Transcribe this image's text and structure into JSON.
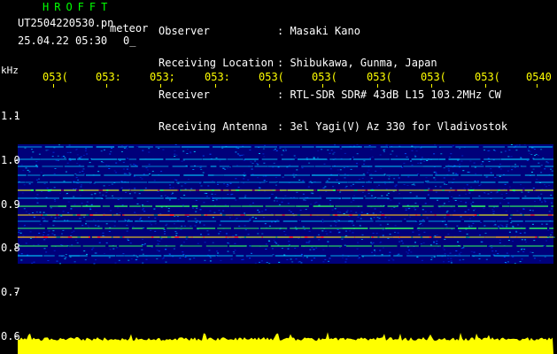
{
  "header": {
    "app_title": "HROFFT",
    "filename": "UT2504220530.pn",
    "meteor_label": "meteor",
    "datetime": "25.04.22 05:30",
    "tail_text": "0_",
    "meta": [
      {
        "label": "Observer",
        "value": ": Masaki Kano"
      },
      {
        "label": "Receiving Location",
        "value": ": Shibukawa, Gunma, Japan"
      },
      {
        "label": "Receiver",
        "value": ": RTL-SDR SDR# 43dB L15 103.2MHz CW"
      },
      {
        "label": "Receiving Antenna",
        "value": ": 3el Yagi(V) Az 330 for Vladivostok"
      }
    ]
  },
  "axis": {
    "unit": "kHz",
    "y_ticks": [
      "1.1",
      "1.0",
      "0.9",
      "0.8",
      "0.7",
      "0.6"
    ],
    "x_ticks": [
      "053(",
      "053:",
      "053;",
      "053:",
      "053(",
      "053(",
      "053(",
      "053(",
      "053(",
      "0540"
    ]
  },
  "colors": {
    "background": "#000000",
    "spectrum_band": "#00007a",
    "axis_text": "#ffffff",
    "tick_text": "#ffff00",
    "title": "#00ff00",
    "signal_hot": "#ff2020",
    "signal_mid": "#30ff60",
    "signal_low": "#00c8ff",
    "bottom_plot": "#ffff00"
  }
}
